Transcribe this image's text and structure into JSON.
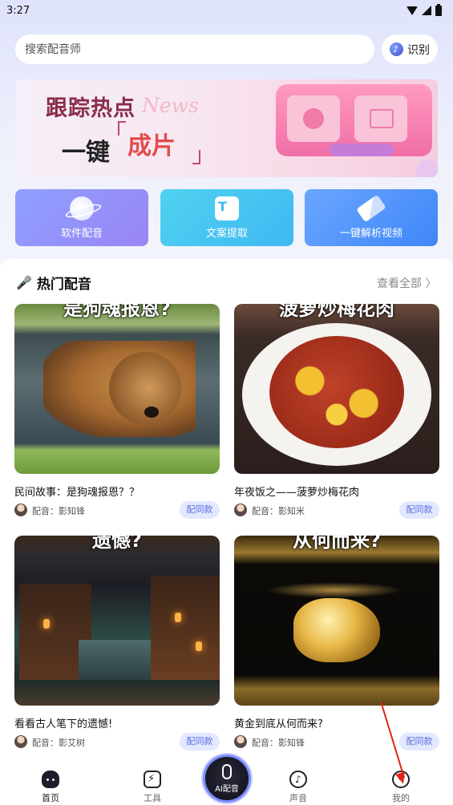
{
  "status_bar": {
    "time": "3:27"
  },
  "search": {
    "placeholder": "搜索配音师",
    "recognize_label": "识别"
  },
  "banner": {
    "line1": "跟踪热点",
    "news_word": "News",
    "line2_prefix": "一键",
    "line2_highlight": "成片"
  },
  "tools": [
    {
      "label": "软件配音",
      "icon": "planet-icon"
    },
    {
      "label": "文案提取",
      "icon": "text-doc-icon"
    },
    {
      "label": "一键解析视频",
      "icon": "eraser-icon"
    }
  ],
  "hot_section": {
    "title": "热门配音",
    "view_all": "查看全部 〉"
  },
  "cards": [
    {
      "caption": "是狗魂报恩?",
      "title": "民间故事：是狗魂报恩？？",
      "voice": "配音：影知锋",
      "button": "配同款"
    },
    {
      "caption": "菠萝炒梅花肉",
      "title": "年夜饭之——菠萝炒梅花肉",
      "voice": "配音：影知米",
      "button": "配同款"
    },
    {
      "caption": "遗憾?",
      "title": "看看古人笔下的遗憾!",
      "voice": "配音：影艾树",
      "button": "配同款"
    },
    {
      "caption": "从何而来?",
      "title": "黄金到底从何而来?",
      "voice": "配音：影知锋",
      "button": "配同款"
    }
  ],
  "bottom_nav": {
    "home": "首页",
    "tools": "工具",
    "center": "AI配音",
    "voice": "声音",
    "me": "我的"
  },
  "colors": {
    "accent": "#5a6fe0",
    "arrow": "#e2231a"
  }
}
